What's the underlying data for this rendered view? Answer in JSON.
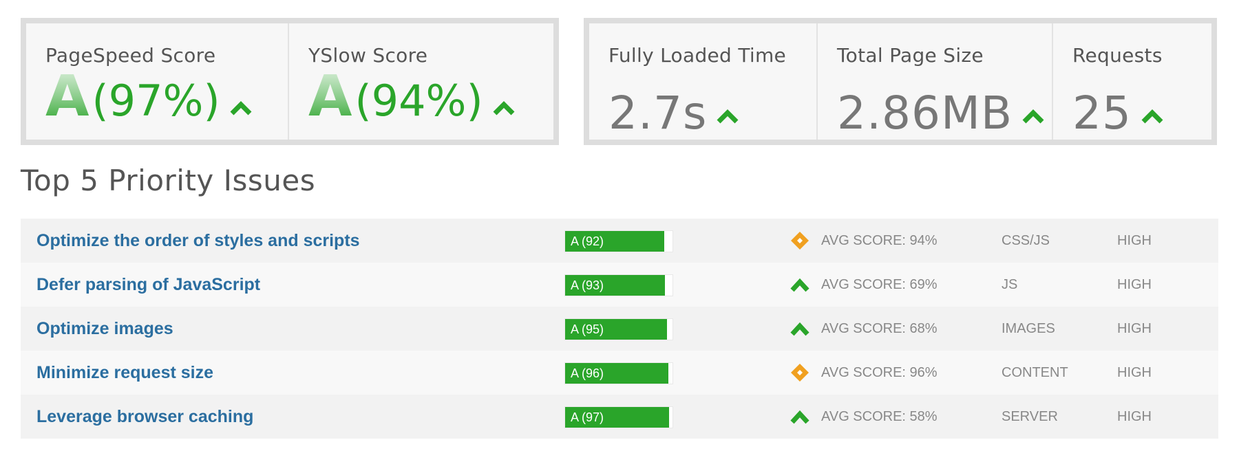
{
  "scores": {
    "pagespeed": {
      "title": "PageSpeed Score",
      "grade": "A",
      "percent": "(97%)"
    },
    "yslow": {
      "title": "YSlow Score",
      "grade": "A",
      "percent": "(94%)"
    }
  },
  "metrics": {
    "fully_loaded": {
      "title": "Fully Loaded Time",
      "value": "2.7s"
    },
    "page_size": {
      "title": "Total Page Size",
      "value": "2.86MB"
    },
    "requests": {
      "title": "Requests",
      "value": "25"
    }
  },
  "section_title": "Top 5 Priority Issues",
  "colors": {
    "green": "#2aa52a",
    "orange": "#f0a020",
    "link": "#2b6ea0"
  },
  "issues": [
    {
      "name": "Optimize the order of styles and scripts",
      "grade_label": "A (92)",
      "score": 92,
      "trend_icon": "diamond-icon",
      "avg": "AVG SCORE: 94%",
      "category": "CSS/JS",
      "priority": "HIGH"
    },
    {
      "name": "Defer parsing of JavaScript",
      "grade_label": "A (93)",
      "score": 93,
      "trend_icon": "arrow-up-icon",
      "avg": "AVG SCORE: 69%",
      "category": "JS",
      "priority": "HIGH"
    },
    {
      "name": "Optimize images",
      "grade_label": "A (95)",
      "score": 95,
      "trend_icon": "arrow-up-icon",
      "avg": "AVG SCORE: 68%",
      "category": "IMAGES",
      "priority": "HIGH"
    },
    {
      "name": "Minimize request size",
      "grade_label": "A (96)",
      "score": 96,
      "trend_icon": "diamond-icon",
      "avg": "AVG SCORE: 96%",
      "category": "CONTENT",
      "priority": "HIGH"
    },
    {
      "name": "Leverage browser caching",
      "grade_label": "A (97)",
      "score": 97,
      "trend_icon": "arrow-up-icon",
      "avg": "AVG SCORE: 58%",
      "category": "SERVER",
      "priority": "HIGH"
    }
  ]
}
